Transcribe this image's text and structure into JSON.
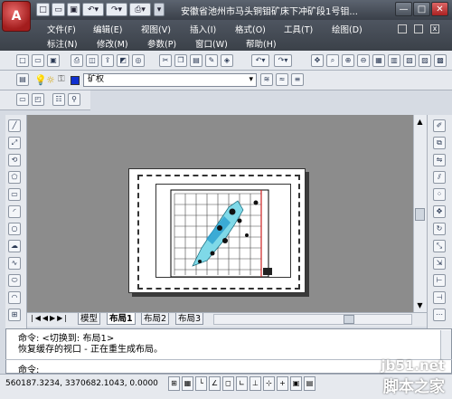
{
  "app": {
    "logo_letter": "A",
    "title": "安徽省池州市马头铜钼矿床下冲矿段1号钼..."
  },
  "window_controls": {
    "minimize": "—",
    "maximize": "□",
    "close": "✕"
  },
  "quick_access": [
    "new-icon",
    "open-icon",
    "save-icon",
    "undo-icon",
    "redo-icon",
    "plot-icon"
  ],
  "menu": {
    "row1": [
      "文件(F)",
      "编辑(E)",
      "视图(V)",
      "插入(I)",
      "格式(O)",
      "工具(T)",
      "绘图(D)"
    ],
    "row2": [
      "标注(N)",
      "修改(M)",
      "参数(P)",
      "窗口(W)",
      "帮助(H)"
    ]
  },
  "layer": {
    "name": "矿权",
    "color": "#1030d0"
  },
  "tabs": {
    "model": "模型",
    "layout1": "布局1",
    "layout2": "布局2",
    "layout3": "布局3",
    "active": "布局1"
  },
  "command": {
    "line1": "命令:  <切换到: 布局1>",
    "line2": "恢复缓存的视口 - 正在重生成布局。",
    "prompt": "命令:"
  },
  "status": {
    "coords": "560187.3234, 3370682.1043, 0.0000"
  },
  "watermark": {
    "line1": "jb51.net",
    "line2": "脚本之家"
  }
}
